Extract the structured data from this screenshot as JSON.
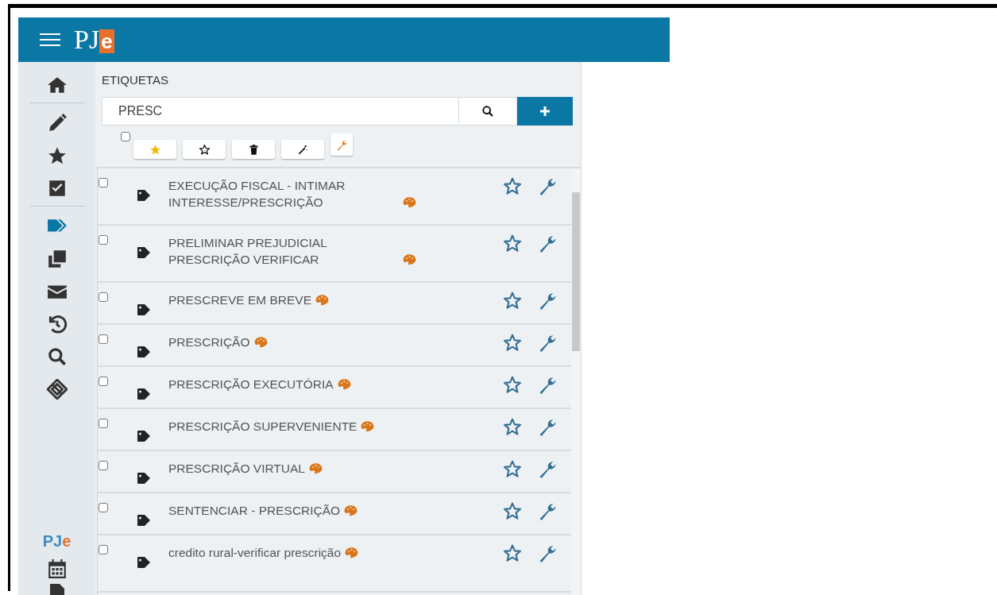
{
  "header": {
    "logo_main": "PJ",
    "logo_accent": "e"
  },
  "sidebar": {
    "items": [
      {
        "selected": false
      },
      {
        "selected": false
      },
      {
        "selected": false
      },
      {
        "selected": false
      },
      {
        "selected": true
      },
      {
        "selected": false
      },
      {
        "selected": false
      },
      {
        "selected": false
      },
      {
        "selected": false
      },
      {
        "selected": false
      }
    ],
    "bottom_logo": {
      "main": "PJ",
      "accent": "e"
    }
  },
  "panel": {
    "title": "ETIQUETAS",
    "search": {
      "value": "PRESC"
    },
    "toolbar": {
      "select_all_checked": false
    },
    "tags": [
      {
        "label": "EXECUÇÃO FISCAL - INTIMAR INTERESSE/PRESCRIÇÃO",
        "checked": false
      },
      {
        "label": "PRELIMINAR PREJUDICIAL PRESCRIÇÃO VERIFICAR",
        "checked": false
      },
      {
        "label": "PRESCREVE EM BREVE",
        "checked": false
      },
      {
        "label": "PRESCRIÇÃO",
        "checked": false
      },
      {
        "label": "PRESCRIÇÃO EXECUTÓRIA",
        "checked": false
      },
      {
        "label": "PRESCRIÇÃO SUPERVENIENTE",
        "checked": false
      },
      {
        "label": "PRESCRIÇÃO VIRTUAL",
        "checked": false
      },
      {
        "label": "SENTENCIAR - PRESCRIÇÃO",
        "checked": false
      },
      {
        "label": "credito rural-verificar prescrição",
        "checked": false
      }
    ]
  }
}
